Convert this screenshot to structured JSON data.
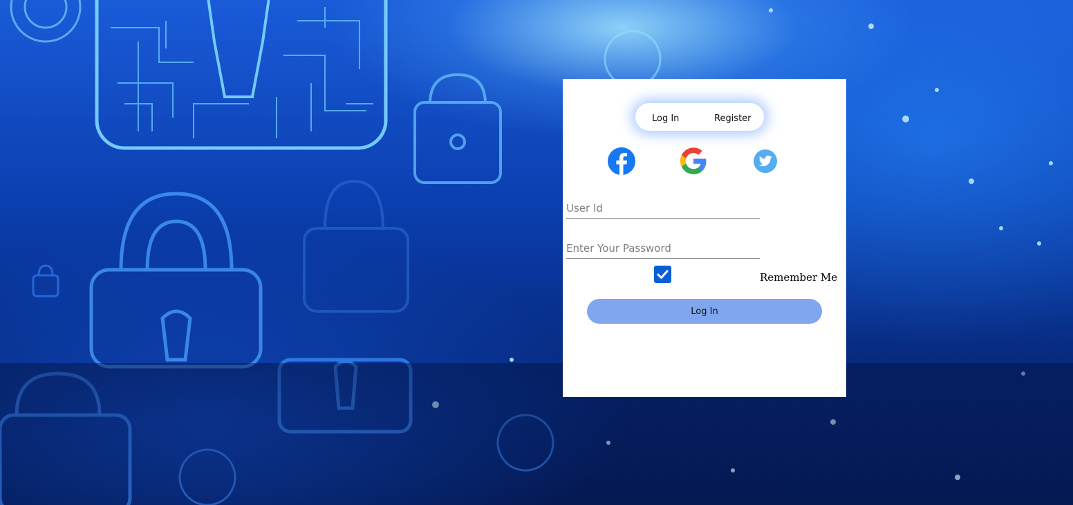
{
  "tabs": {
    "login_label": "Log In",
    "register_label": "Register"
  },
  "social": {
    "facebook": "facebook-icon",
    "google": "google-icon",
    "twitter": "twitter-icon"
  },
  "form": {
    "user_id_placeholder": "User Id",
    "user_id_value": "",
    "password_placeholder": "Enter Your Password",
    "password_value": "",
    "remember_checked": true,
    "remember_label": "Remember Me",
    "submit_label": "Log In"
  },
  "colors": {
    "submit_button": "#7fa6ef",
    "checkbox": "#0b5ed7",
    "facebook": "#1877f2",
    "twitter": "#55acee"
  }
}
